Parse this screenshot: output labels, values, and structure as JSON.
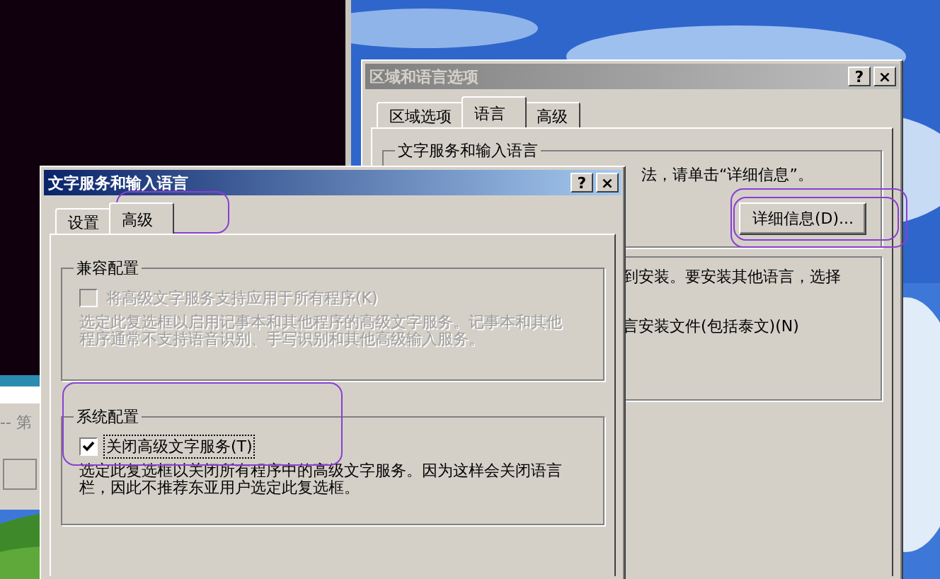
{
  "side_window": {
    "text": "-- 第"
  },
  "back_dialog": {
    "title": "区域和语言选项",
    "active": false,
    "help": "?",
    "close": "×",
    "tabs": [
      {
        "label": "区域选项",
        "selected": false
      },
      {
        "label": "语言",
        "selected": true
      },
      {
        "label": "高级",
        "selected": false
      }
    ],
    "group": {
      "title": "文字服务和输入语言",
      "text": "法，请单击“详细信息”。",
      "button": "详细信息(D)..."
    },
    "group2_lines": [
      "到安装。要安装其他语言，选择",
      "言安装文件(包括泰文)(N)"
    ]
  },
  "front_dialog": {
    "title": "文字服务和输入语言",
    "active": true,
    "help": "?",
    "close": "×",
    "tabs": [
      {
        "label": "设置",
        "selected": false
      },
      {
        "label": "高级",
        "selected": true
      }
    ],
    "groups": [
      {
        "title": "兼容配置",
        "checkbox": {
          "label": "将高级文字服务支持应用于所有程序(K)",
          "checked": false,
          "disabled": true
        },
        "description": "选定此复选框以启用记事本和其他程序的高级文字服务。记事本和其他程序通常不支持语音识别、手写识别和其他高级输入服务。"
      },
      {
        "title": "系统配置",
        "checkbox": {
          "label": "关闭高级文字服务(T)",
          "checked": true,
          "disabled": false
        },
        "description": "选定此复选框以关闭所有程序中的高级文字服务。因为这样会关闭语言栏，因此不推荐东亚用户选定此复选框。"
      }
    ]
  }
}
